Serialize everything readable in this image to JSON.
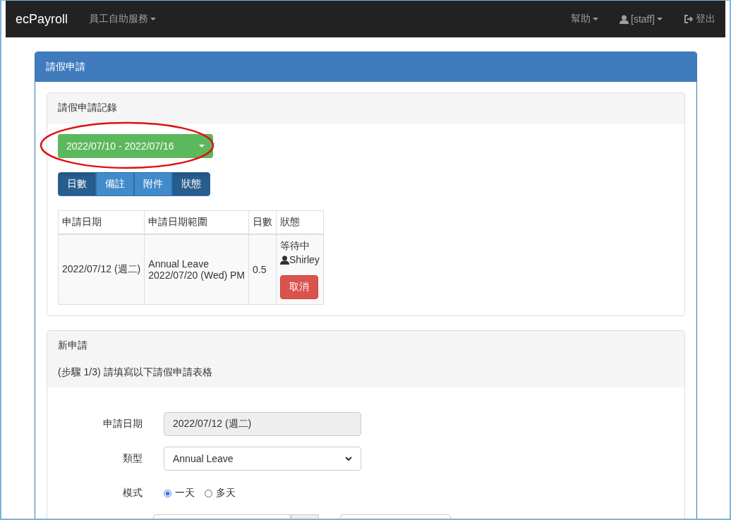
{
  "navbar": {
    "brand": "ecPayroll",
    "menu": "員工自助服務",
    "right_items": [
      {
        "kind": "dropdown",
        "label": "幫助"
      },
      {
        "kind": "user",
        "label": "[staff]"
      },
      {
        "kind": "link",
        "label": "登出"
      }
    ]
  },
  "panel": {
    "title": "請假申請",
    "records": {
      "title": "請假申請記錄",
      "range": "2022/07/10 - 2022/07/16",
      "toggles": [
        {
          "label": "日數",
          "selected": true
        },
        {
          "label": "備註",
          "selected": false
        },
        {
          "label": "附件",
          "selected": false
        },
        {
          "label": "狀態",
          "selected": true
        }
      ],
      "table": {
        "columns": [
          "申請日期",
          "申請日期範圍",
          "日數",
          "狀態"
        ],
        "rows": [
          {
            "date": "2022/07/12 (週二)",
            "type": "Annual Leave",
            "range": "2022/07/20 (Wed) PM",
            "days": "0.5",
            "status": "等待中",
            "approver": "Shirley",
            "action": "取消"
          }
        ]
      }
    },
    "new_request": {
      "title": "新申請",
      "step": "(步驟 1/3) 請填寫以下請假申請表格",
      "form": {
        "date_label": "申請日期",
        "date_value": "2022/07/12 (週二)",
        "type_label": "類型",
        "type_value": "Annual Leave",
        "mode_label": "模式",
        "modes": [
          {
            "label": "一天",
            "selected": true
          },
          {
            "label": "多天",
            "selected": false
          }
        ]
      }
    }
  }
}
